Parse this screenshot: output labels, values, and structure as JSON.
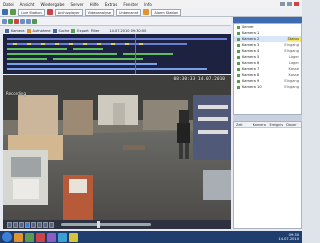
{
  "menu": [
    "Datei",
    "Ansicht",
    "Wiedergabe",
    "Server",
    "Hilfe",
    "Extras",
    "Fenster",
    "Info"
  ],
  "tabs": [
    "Live Station",
    "Archivplayer",
    "Videoanalyse",
    "Unbenannt",
    "Alarm Station"
  ],
  "subbar": {
    "items": [
      "Kamera",
      "Aufnahme",
      "Suche",
      "Export",
      "Filter"
    ],
    "time": "14.07.2010 09:30:00"
  },
  "video": {
    "camera_label": "Recording",
    "timestamp": "08:30:33 14.07.2010"
  },
  "right_panel": {
    "cameras": [
      {
        "name": "Server",
        "status": ""
      },
      {
        "name": "Kamera 1",
        "status": ""
      },
      {
        "name": "Kamera 2",
        "status": "Status"
      },
      {
        "name": "Kamera 3",
        "status": "Eingang"
      },
      {
        "name": "Kamera 4",
        "status": "Eingang"
      },
      {
        "name": "Kamera 5",
        "status": "Lager"
      },
      {
        "name": "Kamera 6",
        "status": "Lager"
      },
      {
        "name": "Kamera 7",
        "status": "Kasse"
      },
      {
        "name": "Kamera 8",
        "status": "Kasse"
      },
      {
        "name": "Kamera 9",
        "status": "Eingang"
      },
      {
        "name": "Kamera 10",
        "status": "Eingang"
      }
    ],
    "events_headers": [
      "Zeit",
      "Kamera",
      "Ereignis",
      "Dauer"
    ]
  },
  "taskbar": {
    "time": "09:30",
    "date": "14.07.2010"
  }
}
